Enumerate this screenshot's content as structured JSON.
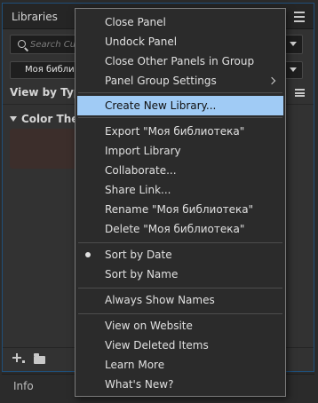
{
  "panel": {
    "title": "Libraries",
    "search_placeholder": "Search Current Library",
    "library_name": "Моя библиотека",
    "view_label": "View by Type",
    "section_color_themes": "Color Themes"
  },
  "info_panel": {
    "tab": "Info"
  },
  "menu": {
    "close_panel": "Close Panel",
    "undock_panel": "Undock Panel",
    "close_other_panels": "Close Other Panels in Group",
    "panel_group_settings": "Panel Group Settings",
    "create_new_library": "Create New Library...",
    "export_library": "Export \"Моя библиотека\"",
    "import_library": "Import Library",
    "collaborate": "Collaborate...",
    "share_link": "Share Link...",
    "rename_library": "Rename \"Моя библиотека\"",
    "delete_library": "Delete \"Моя библиотека\"",
    "sort_by_date": "Sort by Date",
    "sort_by_name": "Sort by Name",
    "always_show_names": "Always Show Names",
    "view_on_website": "View on Website",
    "view_deleted_items": "View Deleted Items",
    "learn_more": "Learn More",
    "whats_new": "What's New?"
  },
  "state": {
    "highlighted_item": "create_new_library",
    "checked_sort": "sort_by_date"
  },
  "colors": {
    "highlight": "#a0cbf5",
    "panel_border": "#1f4f7a"
  }
}
